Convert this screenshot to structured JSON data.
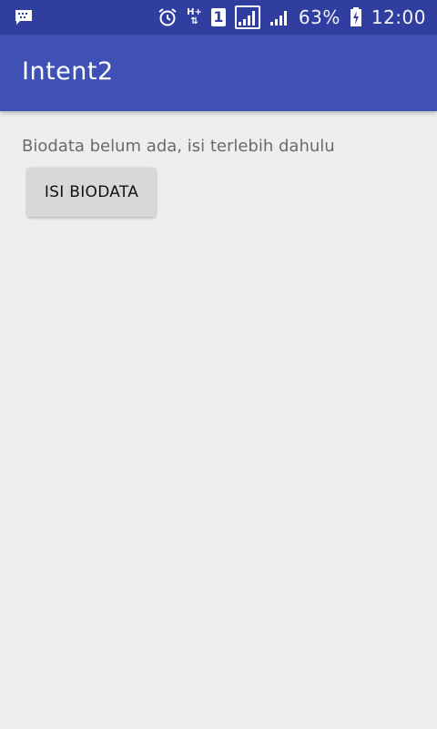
{
  "status_bar": {
    "left_icon": "chat-notification-icon",
    "icons": [
      "alarm-icon",
      "hplus-data-icon",
      "sim-1-icon",
      "signal-strength-icon",
      "signal-strength-2-icon",
      "battery-charging-icon"
    ],
    "sim_label": "1",
    "data_label": "H+",
    "battery_percent": "63%",
    "time": "12:00"
  },
  "app_bar": {
    "title": "Intent2"
  },
  "content": {
    "message": "Biodata belum ada, isi terlebih dahulu",
    "button_label": "ISI BIODATA"
  },
  "colors": {
    "status_bar": "#303f9f",
    "app_bar": "#3f51b5",
    "background": "#eeeeee",
    "button": "#d7d8d7"
  }
}
